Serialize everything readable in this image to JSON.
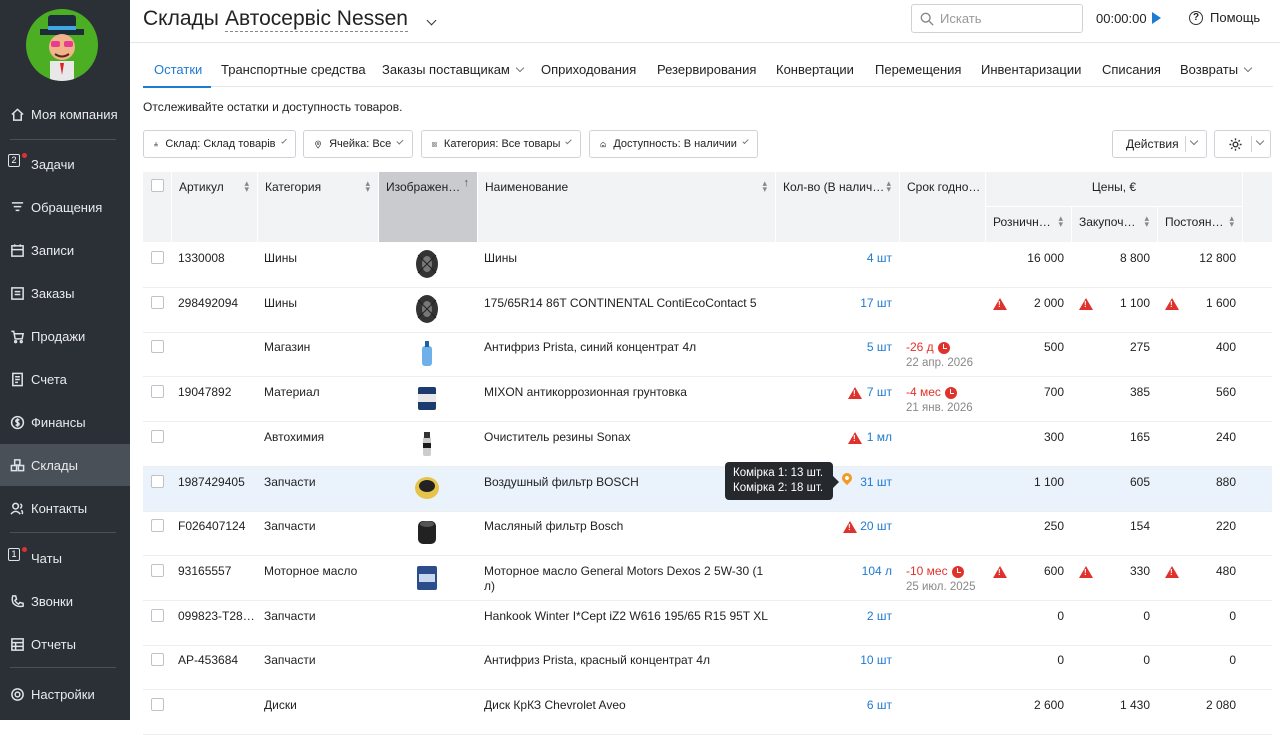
{
  "sidebar": {
    "items": [
      {
        "label": "Моя компания",
        "icon": "home-icon"
      },
      {
        "label": "Задачи",
        "icon": "tasks-icon",
        "badge": "2"
      },
      {
        "label": "Обращения",
        "icon": "filter-icon"
      },
      {
        "label": "Записи",
        "icon": "calendar-icon"
      },
      {
        "label": "Заказы",
        "icon": "orders-icon"
      },
      {
        "label": "Продажи",
        "icon": "cart-icon"
      },
      {
        "label": "Счета",
        "icon": "invoice-icon"
      },
      {
        "label": "Финансы",
        "icon": "dollar-icon"
      },
      {
        "label": "Склады",
        "icon": "warehouse-icon"
      },
      {
        "label": "Контакты",
        "icon": "contacts-icon"
      },
      {
        "label": "Чаты",
        "icon": "chat-icon",
        "badge": "1"
      },
      {
        "label": "Звонки",
        "icon": "phone-icon"
      },
      {
        "label": "Отчеты",
        "icon": "reports-icon"
      },
      {
        "label": "Настройки",
        "icon": "settings-icon"
      }
    ]
  },
  "header": {
    "title": "Склады",
    "company": "Автосервіс Nessen",
    "search_placeholder": "Искать",
    "timer": "00:00:00",
    "help": "Помощь"
  },
  "tabs": [
    {
      "label": "Остатки"
    },
    {
      "label": "Транспортные средства"
    },
    {
      "label": "Заказы поставщикам"
    },
    {
      "label": "Оприходования"
    },
    {
      "label": "Резервирования"
    },
    {
      "label": "Конвертации"
    },
    {
      "label": "Перемещения"
    },
    {
      "label": "Инвентаризации"
    },
    {
      "label": "Списания"
    },
    {
      "label": "Возвраты"
    }
  ],
  "subtitle": "Отслеживайте остатки и доступность товаров.",
  "filters": {
    "warehouse": "Склад: Склад товарів",
    "cell": "Ячейка: Все",
    "category": "Категория: Все товары",
    "availability": "Доступность: В наличии"
  },
  "actions_label": "Действия",
  "table": {
    "headers": {
      "article": "Артикул",
      "category": "Категория",
      "image": "Изображен…",
      "name": "Наименование",
      "qty": "Кол-во (В налич…",
      "expiry": "Срок годно…",
      "prices": "Цены, €",
      "retail": "Розничн…",
      "purchase": "Закупоч…",
      "regular": "Постоян…"
    },
    "rows": [
      {
        "article": "1330008",
        "category": "Шины",
        "name": "Шины",
        "qty": "4 шт",
        "expiry": "",
        "expiry_date": "",
        "retail": "16 000",
        "purchase": "8 800",
        "regular": "12 800"
      },
      {
        "article": "298492094",
        "category": "Шины",
        "name": "175/65R14 86T CONTINENTAL ContiEcoContact 5",
        "qty": "17 шт",
        "expiry": "",
        "expiry_date": "",
        "retail": "2 000",
        "purchase": "1 100",
        "regular": "1 600"
      },
      {
        "article": "",
        "category": "Магазин",
        "name": "Антифриз Prista, синий концентрат 4л",
        "qty": "5 шт",
        "expiry": "-26 д",
        "expiry_date": "22 апр. 2026",
        "retail": "500",
        "purchase": "275",
        "regular": "400"
      },
      {
        "article": "19047892",
        "category": "Материал",
        "name": "MIXON антикоррозионная грунтовка",
        "qty": "7 шт",
        "expiry": "-4 мес",
        "expiry_date": "21 янв. 2026",
        "retail": "700",
        "purchase": "385",
        "regular": "560"
      },
      {
        "article": "",
        "category": "Автохимия",
        "name": "Очиститель резины Sonax",
        "qty": "1 мл",
        "expiry": "",
        "expiry_date": "",
        "retail": "300",
        "purchase": "165",
        "regular": "240"
      },
      {
        "article": "1987429405",
        "category": "Запчасти",
        "name": "Воздушный фильтр BOSCH",
        "qty": "31 шт",
        "expiry": "",
        "expiry_date": "",
        "retail": "1 100",
        "purchase": "605",
        "regular": "880"
      },
      {
        "article": "F026407124",
        "category": "Запчасти",
        "name": "Масляный фильтр Bosch",
        "qty": "20 шт",
        "expiry": "",
        "expiry_date": "",
        "retail": "250",
        "purchase": "154",
        "regular": "220"
      },
      {
        "article": "93165557",
        "category": "Моторное масло",
        "name": "Моторное масло General Motors Dexos 2 5W-30 (1",
        "name2": "л)",
        "qty": "104 л",
        "expiry": "-10 мес",
        "expiry_date": "25 июл. 2025",
        "retail": "600",
        "purchase": "330",
        "regular": "480"
      },
      {
        "article": "099823-T28…",
        "category": "Запчасти",
        "name": "Hankook Winter I*Cept iZ2 W616 195/65 R15 95T XL",
        "qty": "2 шт",
        "expiry": "",
        "expiry_date": "",
        "retail": "0",
        "purchase": "0",
        "regular": "0"
      },
      {
        "article": "AP-453684",
        "category": "Запчасти",
        "name": "Антифриз Prista, красный концентрат 4л",
        "qty": "10 шт",
        "expiry": "",
        "expiry_date": "",
        "retail": "0",
        "purchase": "0",
        "regular": "0"
      },
      {
        "article": "",
        "category": "Диски",
        "name": "Диск КрКЗ Chevrolet Aveo",
        "qty": "6 шт",
        "expiry": "",
        "expiry_date": "",
        "retail": "2 600",
        "purchase": "1 430",
        "regular": "2 080"
      }
    ]
  },
  "tooltip": {
    "line1": "Комірка 1: 13 шт.",
    "line2": "Комірка 2: 18 шт."
  },
  "colors": {
    "accent": "#1f7ad1",
    "sidebar": "#2b3036",
    "warning": "#e0322c",
    "highlight": "#eaf2fc"
  }
}
